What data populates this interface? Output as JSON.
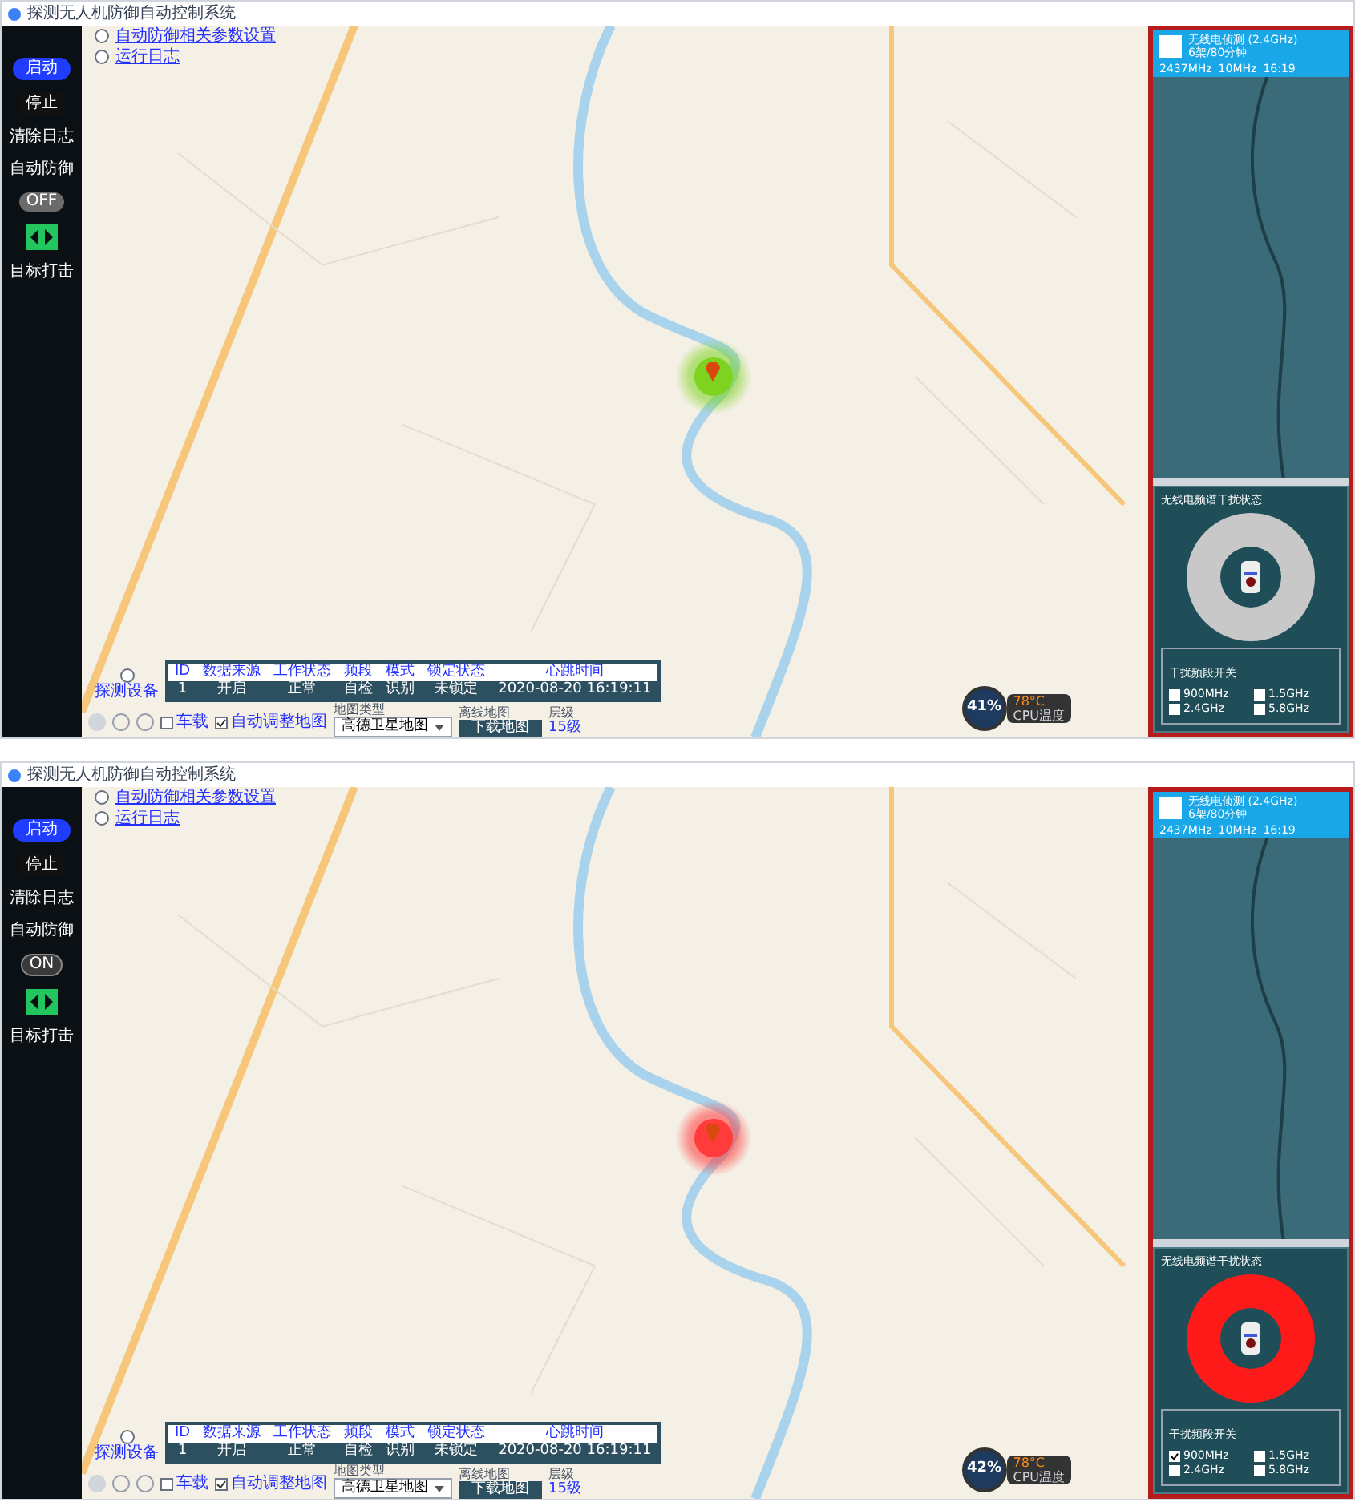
{
  "screens": [
    {
      "window": {
        "title": "探测无人机防御自动控制系统"
      },
      "sidebar": {
        "start": "启动",
        "stop": "停止",
        "clear": "清除日志",
        "auto_label": "自动防御",
        "switch": {
          "on": false,
          "text": "OFF"
        },
        "strike": "目标打击"
      },
      "links": [
        "自动防御相关参数设置",
        "运行日志"
      ],
      "marker": {
        "color": "#7ed321"
      },
      "table": {
        "caption": "探测设备",
        "columns": [
          "ID",
          "数据来源",
          "工作状态",
          "频段",
          "模式",
          "锁定状态",
          "心跳时间"
        ],
        "rows": [
          [
            "1",
            "开启",
            "正常",
            "自检",
            "识别",
            "未锁定",
            "2020-08-20 16:19:11"
          ]
        ]
      },
      "toolbar": {
        "checks": [
          {
            "label": "车载",
            "checked": false
          },
          {
            "label": "自动调整地图",
            "checked": true
          }
        ],
        "map_label": "地图类型",
        "select": "高德卫星地图",
        "download_label": "离线地图",
        "download": "下载地图",
        "zoom_label": "层级",
        "zoom": "15级"
      },
      "gauge": {
        "value": "41%",
        "temp": "78°C",
        "temp_label": "CPU温度"
      },
      "panel": {
        "header": [
          "无线电侦测 (2.4GHz)",
          "6架/80分钟"
        ],
        "readings": [
          "2437MHz",
          "10MHz",
          "16:19"
        ],
        "status_title": "无线电频谱干扰状态",
        "jamming": false,
        "bands_title": "干扰频段开关",
        "bands": [
          {
            "label": "900MHz",
            "checked": false
          },
          {
            "label": "1.5GHz",
            "checked": false
          },
          {
            "label": "2.4GHz",
            "checked": false
          },
          {
            "label": "5.8GHz",
            "checked": false
          }
        ]
      }
    },
    {
      "window": {
        "title": "探测无人机防御自动控制系统"
      },
      "sidebar": {
        "start": "启动",
        "stop": "停止",
        "clear": "清除日志",
        "auto_label": "自动防御",
        "switch": {
          "on": true,
          "text": "ON"
        },
        "strike": "目标打击"
      },
      "links": [
        "自动防御相关参数设置",
        "运行日志"
      ],
      "marker": {
        "color": "#ff3b3b"
      },
      "table": {
        "caption": "探测设备",
        "columns": [
          "ID",
          "数据来源",
          "工作状态",
          "频段",
          "模式",
          "锁定状态",
          "心跳时间"
        ],
        "rows": [
          [
            "1",
            "开启",
            "正常",
            "自检",
            "识别",
            "未锁定",
            "2020-08-20 16:19:11"
          ]
        ]
      },
      "toolbar": {
        "checks": [
          {
            "label": "车载",
            "checked": false
          },
          {
            "label": "自动调整地图",
            "checked": true
          }
        ],
        "map_label": "地图类型",
        "select": "高德卫星地图",
        "download_label": "离线地图",
        "download": "下载地图",
        "zoom_label": "层级",
        "zoom": "15级"
      },
      "gauge": {
        "value": "42%",
        "temp": "78°C",
        "temp_label": "CPU温度"
      },
      "panel": {
        "header": [
          "无线电侦测 (2.4GHz)",
          "6架/80分钟"
        ],
        "readings": [
          "2437MHz",
          "10MHz",
          "16:19"
        ],
        "status_title": "无线电频谱干扰状态",
        "jamming": true,
        "bands_title": "干扰频段开关",
        "bands": [
          {
            "label": "900MHz",
            "checked": true
          },
          {
            "label": "1.5GHz",
            "checked": false
          },
          {
            "label": "2.4GHz",
            "checked": false
          },
          {
            "label": "5.8GHz",
            "checked": false
          }
        ]
      }
    }
  ]
}
